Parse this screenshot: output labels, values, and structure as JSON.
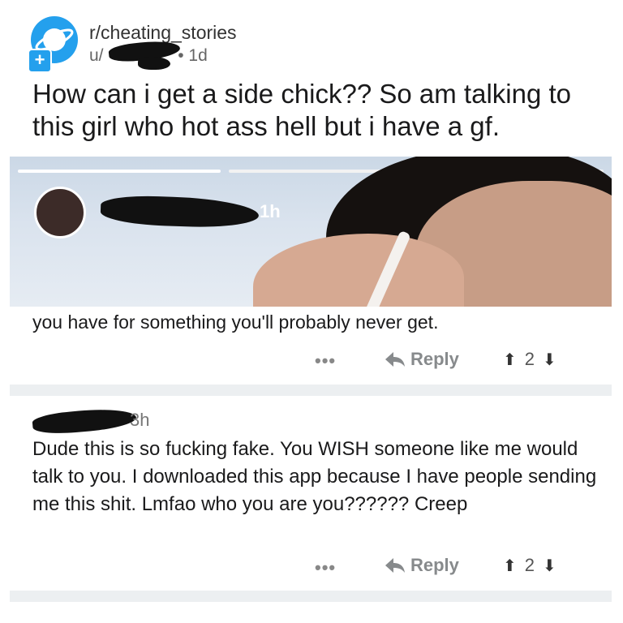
{
  "post": {
    "subreddit": "r/cheating_stories",
    "user_prefix": "u/",
    "age": "• 1d",
    "title": "How can i get a side chick?? So am talking to this girl who hot ass hell but i have a gf."
  },
  "story": {
    "time": "1h",
    "reply_text": "you have for something you'll probably never get."
  },
  "actions_1": {
    "more": "•••",
    "reply_label": "Reply",
    "votes": "2"
  },
  "comment": {
    "time": "3h",
    "text": "Dude this is so fucking fake. You WISH someone like me would talk to you. I downloaded this app because I have people sending me this shit. Lmfao who you are you?????? Creep"
  },
  "actions_2": {
    "more": "•••",
    "reply_label": "Reply",
    "votes": "2"
  },
  "icons": {
    "subreddit": "planet-icon",
    "join": "plus-icon",
    "reply": "reply-arrow-icon",
    "upvote": "upvote-icon",
    "downvote": "downvote-icon"
  },
  "colors": {
    "accent": "#24a0ed",
    "divider": "#eceff1"
  }
}
